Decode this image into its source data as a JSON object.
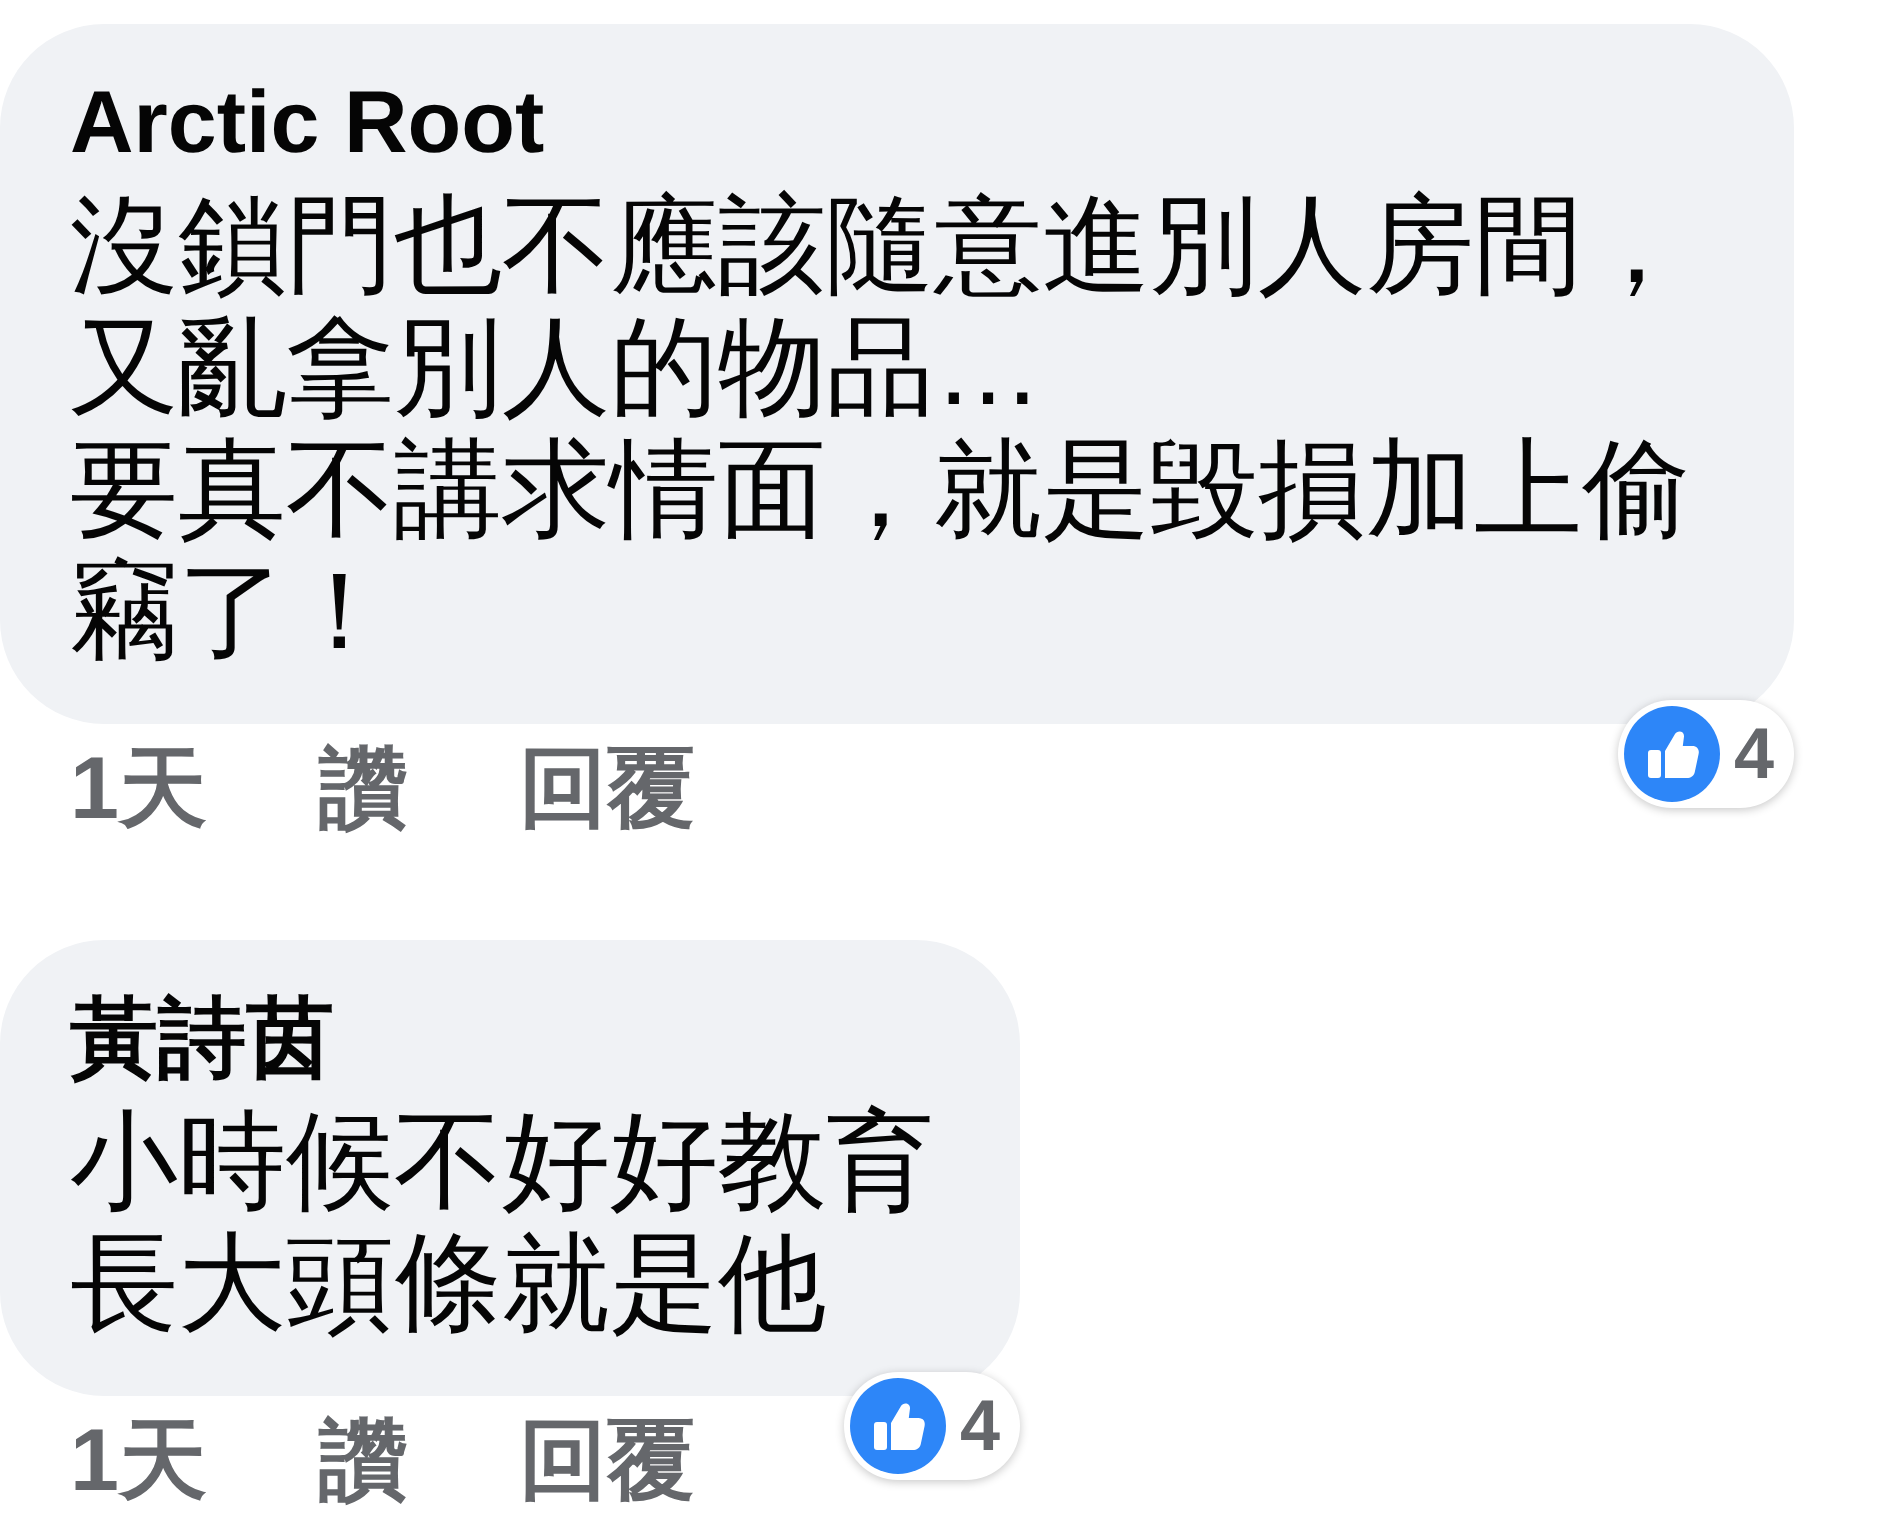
{
  "comments": [
    {
      "author": "Arctic Root",
      "text_lines": [
        "沒鎖門也不應該隨意進別人房間，又亂拿別人的物品…",
        "要真不講求情面，就是毀損加上偷竊了！"
      ],
      "reaction_count": "4",
      "time": "1天",
      "actions": [
        "讚",
        "回覆"
      ]
    },
    {
      "author": "黃詩茵",
      "text_lines": [
        "小時候不好好教育",
        "長大頭條就是他"
      ],
      "reaction_count": "4",
      "time": "1天",
      "actions": [
        "讚",
        "回覆"
      ]
    }
  ]
}
